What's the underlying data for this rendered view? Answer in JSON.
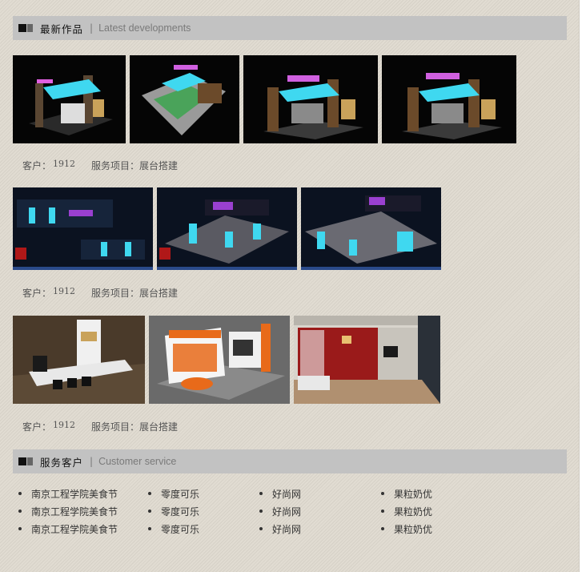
{
  "latest": {
    "title": "最新作品",
    "separator": "|",
    "subtitle": "Latest developments"
  },
  "works": [
    {
      "client_label": "客户：",
      "client_value": "1912",
      "service_label": "服务项目：",
      "service_value": "展台搭建",
      "images": [
        "booth-render-1",
        "booth-render-2",
        "booth-render-3",
        "booth-render-4"
      ]
    },
    {
      "client_label": "客户：",
      "client_value": "1912",
      "service_label": "服务项目：",
      "service_value": "展台搭建",
      "images": [
        "hall-render-1",
        "hall-render-2",
        "hall-render-3"
      ]
    },
    {
      "client_label": "客户：",
      "client_value": "1912",
      "service_label": "服务项目：",
      "service_value": "展台搭建",
      "images": [
        "white-booth-render",
        "orange-booth-render",
        "living-room-render"
      ]
    }
  ],
  "customers": {
    "title": "服务客户",
    "separator": "|",
    "subtitle": "Customer service",
    "rows": [
      [
        "南京工程学院美食节",
        "零度可乐",
        "好尚网",
        "果粒奶优"
      ],
      [
        "南京工程学院美食节",
        "零度可乐",
        "好尚网",
        "果粒奶优"
      ],
      [
        "南京工程学院美食节",
        "零度可乐",
        "好尚网",
        "果粒奶优"
      ]
    ]
  },
  "colors": {
    "header_bg": "#c2c2c2",
    "page_bg": "#ddd8ce",
    "accent_cyan": "#3fd8f0",
    "accent_purple": "#b040d8",
    "accent_orange": "#e86a1a"
  }
}
